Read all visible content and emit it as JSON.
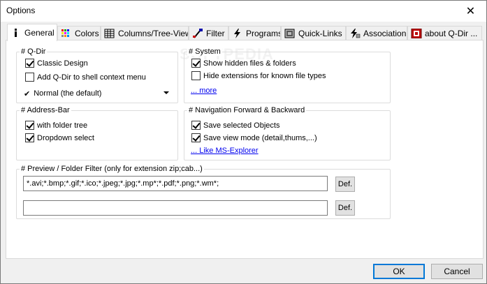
{
  "window": {
    "title": "Options",
    "close_glyph": "✕"
  },
  "tabs": [
    {
      "label": "General",
      "icon": "info-icon",
      "active": true
    },
    {
      "label": "Colors",
      "icon": "palette-icon"
    },
    {
      "label": "Columns/Tree-View",
      "icon": "columns-icon"
    },
    {
      "label": "Filter",
      "icon": "filter-brush-icon"
    },
    {
      "label": "Programs",
      "icon": "lightning-icon"
    },
    {
      "label": "Quick-Links",
      "icon": "grid-icon"
    },
    {
      "label": "Association",
      "icon": "association-icon"
    },
    {
      "label": "about Q-Dir ...",
      "icon": "about-icon"
    }
  ],
  "qdir": {
    "legend": "# Q-Dir",
    "classic_design": "Classic Design",
    "add_shell": "Add Q-Dir to shell context menu",
    "dropdown_check": "✔",
    "dropdown_value": "Normal (the default)"
  },
  "system": {
    "legend": "# System",
    "show_hidden": "Show hidden files & folders",
    "hide_ext": "Hide extensions for known file types",
    "more": "... more"
  },
  "address_bar": {
    "legend": "# Address-Bar",
    "folder_tree": "with folder tree",
    "dropdown_select": "Dropdown select"
  },
  "navigation": {
    "legend": "# Navigation Forward & Backward",
    "save_selected": "Save selected Objects",
    "save_view": "Save view mode (detail,thums,...)",
    "like_explorer": "... Like MS-Explorer"
  },
  "preview": {
    "legend": "# Preview / Folder Filter (only for extension zip;cab...)",
    "filter1": "*.avi;*.bmp;*.gif;*.ico;*.jpeg;*.jpg;*.mp*;*.pdf;*.png;*.wm*;",
    "filter2": "",
    "def_label": "Def."
  },
  "buttons": {
    "ok": "OK",
    "cancel": "Cancel"
  },
  "watermark": "SOFTPEDIA"
}
